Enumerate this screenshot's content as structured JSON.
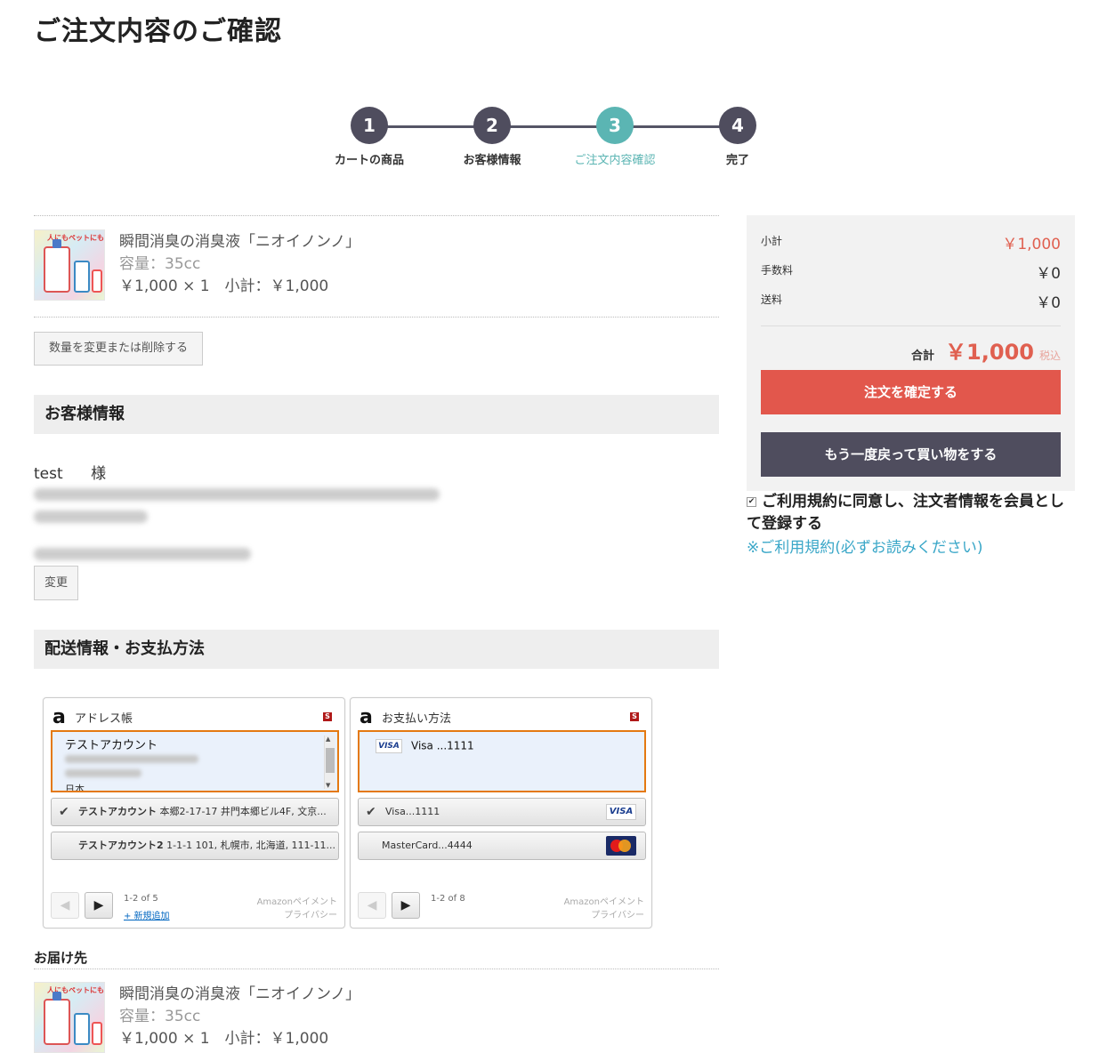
{
  "page": {
    "title": "ご注文内容のご確認"
  },
  "stepper": {
    "steps": [
      {
        "num": "1",
        "label": "カートの商品"
      },
      {
        "num": "2",
        "label": "お客様情報"
      },
      {
        "num": "3",
        "label": "ご注文内容確認"
      },
      {
        "num": "4",
        "label": "完了"
      }
    ],
    "active": 3
  },
  "product": {
    "name": "瞬間消臭の消臭液「ニオイノンノ」",
    "spec": "容量：35cc",
    "price_line": "￥1,000 × 1　小計：￥1,000",
    "thumb_tag": "人にもペットにも安心して使える!"
  },
  "buttons": {
    "change_qty": "数量を変更または削除する",
    "change": "変更"
  },
  "customer": {
    "section_title": "お客様情報",
    "name": "test",
    "honorific": "様"
  },
  "delivery_payment": {
    "section_title": "配送情報・お支払方法"
  },
  "address_widget": {
    "title": "アドレス帳",
    "badge": "S",
    "selected_name": "テストアカウント",
    "selected_country": "日本",
    "rows": [
      {
        "name": "テストアカウント",
        "detail": " 本郷2-17-17 井門本郷ビル4F, 文京..."
      },
      {
        "name": "テストアカウント2",
        "detail": " 1-1-1 101, 札幌市, 北海道, 111-11..."
      }
    ],
    "pager_info": "1-2 of 5",
    "add_new": "+ 新規追加",
    "links": [
      "Amazonペイメント",
      "プライバシー"
    ]
  },
  "payment_widget": {
    "title": "お支払い方法",
    "badge": "S",
    "selected": {
      "brand": "VISA",
      "text": "Visa ...1111"
    },
    "rows": [
      {
        "text": "Visa...1111",
        "card": "VISA"
      },
      {
        "text": "MasterCard...4444",
        "card": "MasterCard"
      }
    ],
    "pager_info": "1-2 of 8",
    "links": [
      "Amazonペイメント",
      "プライバシー"
    ]
  },
  "shipping": {
    "title": "お届け先"
  },
  "summary": {
    "subtotal_label": "小計",
    "subtotal": "￥1,000",
    "fee_label": "手数料",
    "fee": "￥0",
    "shipping_label": "送料",
    "shipping": "￥0",
    "total_label": "合計",
    "total": "￥1,000",
    "tax_note": "税込",
    "confirm_button": "注文を確定する",
    "back_button": "もう一度戻って買い物をする"
  },
  "agreement": {
    "text": "ご利用規約に同意し、注文者情報を会員として登録する",
    "checked": true,
    "terms_link": "※ご利用規約(必ずお読みください)"
  },
  "colors": {
    "accent_teal": "#5bb5b3",
    "dark": "#4f4d5e",
    "red": "#e2574c",
    "link": "#3aa7c8",
    "amazon_orange": "#e47911"
  }
}
